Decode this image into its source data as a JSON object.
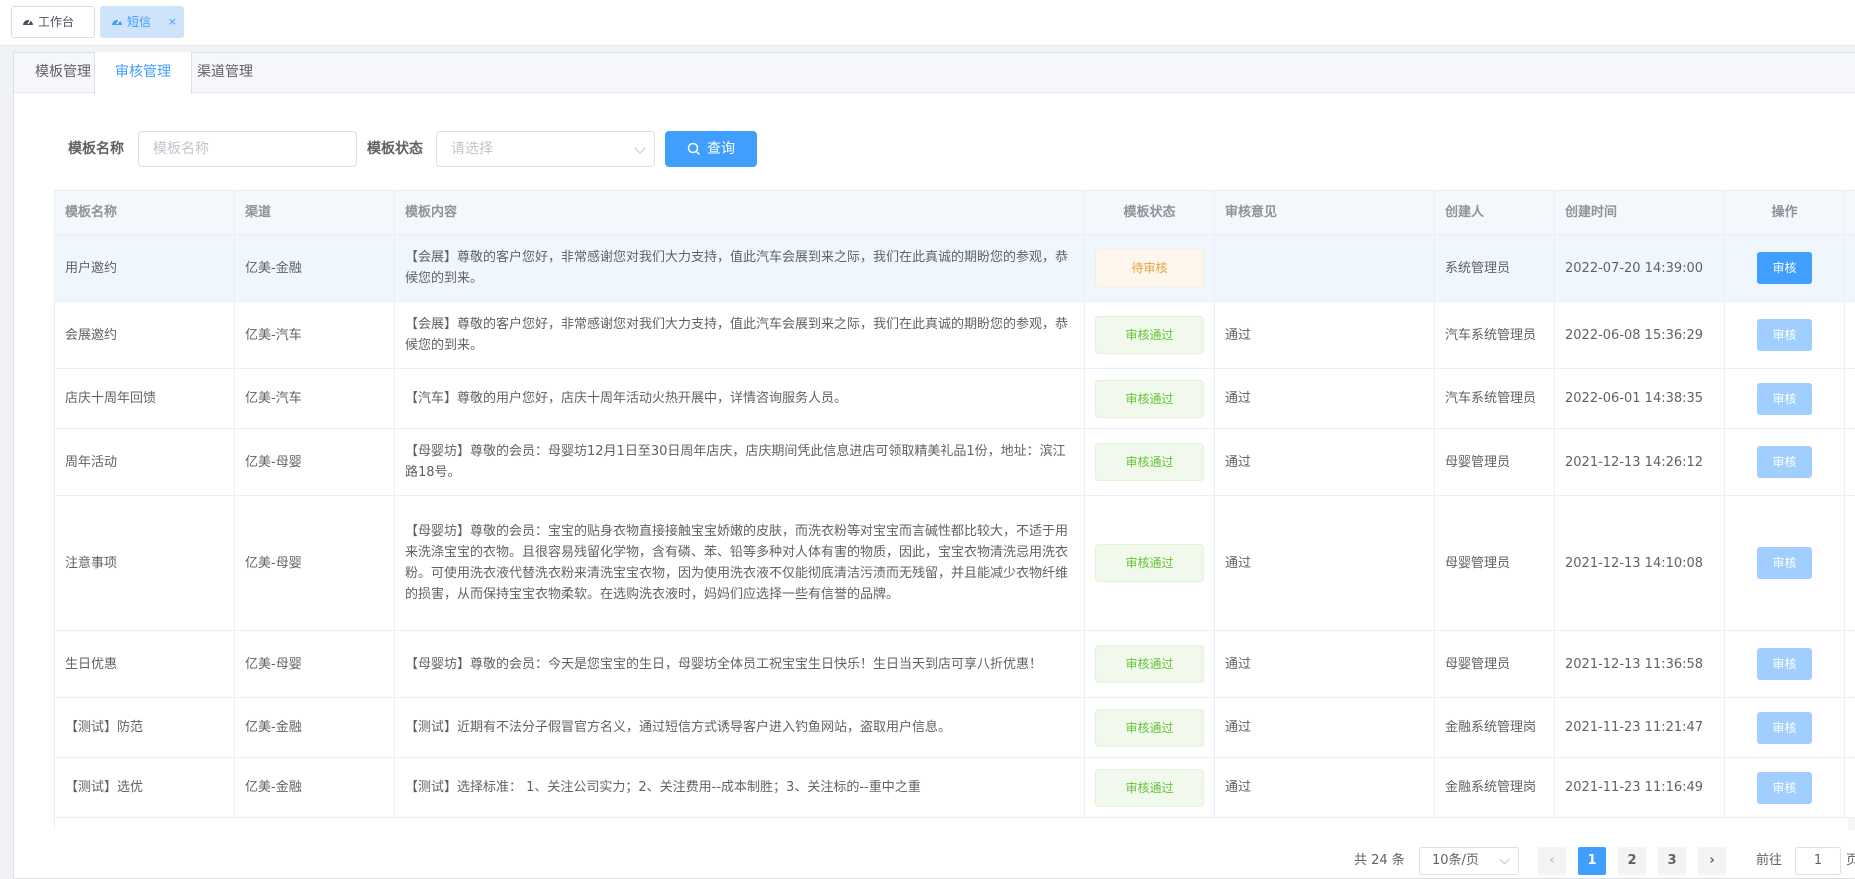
{
  "tags": [
    {
      "label": "工作台",
      "icon": "dashboard-icon",
      "active": false
    },
    {
      "label": "短信",
      "icon": "dashboard-icon",
      "active": true,
      "close": "×"
    }
  ],
  "tabs": [
    {
      "label": "模板管理",
      "active": false
    },
    {
      "label": "审核管理",
      "active": true
    },
    {
      "label": "渠道管理",
      "active": false
    }
  ],
  "search": {
    "name_label": "模板名称",
    "name_placeholder": "模板名称",
    "status_label": "模板状态",
    "status_placeholder": "请选择",
    "query_label": "查询"
  },
  "table": {
    "columns": [
      "模板名称",
      "渠道",
      "模板内容",
      "模板状态",
      "审核意见",
      "创建人",
      "创建时间",
      "操作"
    ],
    "rows": [
      {
        "name": "用户邀约",
        "channel": "亿美-金融",
        "content": "【会展】尊敬的客户您好，非常感谢您对我们大力支持，值此汽车会展到来之际，我们在此真诚的期盼您的参观，恭候您的到来。",
        "status": "待审核",
        "status_type": "pending",
        "opinion": "",
        "creator": "系统管理员",
        "time": "2022-07-20 14:39:00",
        "action": "审核"
      },
      {
        "name": "会展邀约",
        "channel": "亿美-汽车",
        "content": "【会展】尊敬的客户您好，非常感谢您对我们大力支持，值此汽车会展到来之际，我们在此真诚的期盼您的参观，恭候您的到来。",
        "status": "审核通过",
        "status_type": "ok",
        "opinion": "通过",
        "creator": "汽车系统管理员",
        "time": "2022-06-08 15:36:29",
        "action": "审核"
      },
      {
        "name": "店庆十周年回馈",
        "channel": "亿美-汽车",
        "content": "【汽车】尊敬的用户您好，店庆十周年活动火热开展中，详情咨询服务人员。",
        "status": "审核通过",
        "status_type": "ok",
        "opinion": "通过",
        "creator": "汽车系统管理员",
        "time": "2022-06-01 14:38:35",
        "action": "审核"
      },
      {
        "name": "周年活动",
        "channel": "亿美-母婴",
        "content": "【母婴坊】尊敬的会员：母婴坊12月1日至30日周年店庆，店庆期间凭此信息进店可领取精美礼品1份，地址：滨江路18号。",
        "status": "审核通过",
        "status_type": "ok",
        "opinion": "通过",
        "creator": "母婴管理员",
        "time": "2021-12-13 14:26:12",
        "action": "审核"
      },
      {
        "name": "注意事项",
        "channel": "亿美-母婴",
        "content": "【母婴坊】尊敬的会员：宝宝的贴身衣物直接接触宝宝娇嫩的皮肤，而洗衣粉等对宝宝而言碱性都比较大，不适于用来洗涤宝宝的衣物。且很容易残留化学物，含有磷、苯、铅等多种对人体有害的物质，因此，宝宝衣物清洗忌用洗衣粉。可使用洗衣液代替洗衣粉来清洗宝宝衣物，因为使用洗衣液不仅能彻底清洁污渍而无残留，并且能减少衣物纤维的损害，从而保持宝宝衣物柔软。在选购洗衣液时，妈妈们应选择一些有信誉的品牌。",
        "status": "审核通过",
        "status_type": "ok",
        "opinion": "通过",
        "creator": "母婴管理员",
        "time": "2021-12-13 14:10:08",
        "action": "审核"
      },
      {
        "name": "生日优惠",
        "channel": "亿美-母婴",
        "content": "【母婴坊】尊敬的会员：今天是您宝宝的生日，母婴坊全体员工祝宝宝生日快乐！生日当天到店可享八折优惠！",
        "status": "审核通过",
        "status_type": "ok",
        "opinion": "通过",
        "creator": "母婴管理员",
        "time": "2021-12-13 11:36:58",
        "action": "审核"
      },
      {
        "name": "【测试】防范",
        "channel": "亿美-金融",
        "content": "【测试】近期有不法分子假冒官方名义，通过短信方式诱导客户进入钓鱼网站，盗取用户信息。",
        "status": "审核通过",
        "status_type": "ok",
        "opinion": "通过",
        "creator": "金融系统管理岗",
        "time": "2021-11-23 11:21:47",
        "action": "审核"
      },
      {
        "name": "【测试】选优",
        "channel": "亿美-金融",
        "content": "【测试】选择标准： 1、关注公司实力；2、关注费用--成本制胜；3、关注标的--重中之重",
        "status": "审核通过",
        "status_type": "ok",
        "opinion": "通过",
        "creator": "金融系统管理岗",
        "time": "2021-11-23 11:16:49",
        "action": "审核"
      }
    ]
  },
  "pagination": {
    "total": "共 24 条",
    "page_size": "10条/页",
    "prev": "‹",
    "pages": [
      "1",
      "2",
      "3"
    ],
    "current": "1",
    "next": "›",
    "goto_label": "前往",
    "goto_value": "1",
    "goto_unit": "页"
  },
  "colors": {
    "primary": "#409eff",
    "pending": "#e6a23c",
    "success": "#67c23a"
  }
}
